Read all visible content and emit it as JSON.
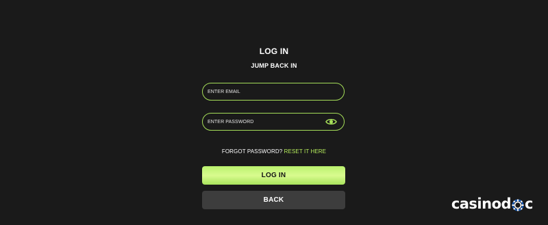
{
  "login": {
    "title": "LOG IN",
    "subtitle": "JUMP BACK IN",
    "email_placeholder": "ENTER EMAIL",
    "password_placeholder": "ENTER PASSWORD",
    "forgot_text": "FORGOT PASSWORD?",
    "reset_link": "RESET IT HERE",
    "login_button": "LOG IN",
    "back_button": "BACK"
  },
  "logo": {
    "text_before": "casinod",
    "text_after": "c"
  },
  "icons": {
    "password_toggle": "eye-icon",
    "logo_chip": "poker-chip-icon"
  },
  "colors": {
    "background": "#1a1a1a",
    "accent": "#a6df59",
    "link": "#b7ee5c",
    "back_button": "#3d3d3d"
  }
}
